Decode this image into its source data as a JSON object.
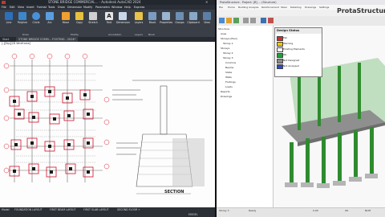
{
  "autocad": {
    "title": "STONE BRIDGE COMMERCIAL... - Autodesk AutoCAD 2024",
    "menu": [
      "File",
      "Edit",
      "View",
      "Insert",
      "Format",
      "Tools",
      "Draw",
      "Dimension",
      "Modify",
      "Parametric",
      "Window",
      "Help",
      "Express"
    ],
    "ribbon_tabs": [
      "Home",
      "Insert",
      "Annotate",
      "Parametric",
      "View",
      "Manage",
      "Output",
      "Add-ins",
      "Collaborate",
      "Express Tools",
      "Featured Apps"
    ],
    "ribbon_buttons": [
      "Line",
      "Polyline",
      "Circle",
      "Arc",
      "Move",
      "Copy",
      "Stretch",
      "Text",
      "Dimension",
      "Layers",
      "Block",
      "Properties",
      "Groups",
      "Utilities",
      "Clipboard",
      "View"
    ],
    "groups": [
      "Draw",
      "Modify",
      "Annotation",
      "Layers",
      "Block"
    ],
    "file_tabs": [
      "Start",
      "STONE BRIDGE COMM... FOOTING - 2024*"
    ],
    "viewport_label": "[-][Top][2D Wireframe]",
    "section_label": "SECTION",
    "layout_tabs": [
      "Model",
      "FOUNDATION LAYOUT",
      "FIRST BEAM LAYOUT",
      "FIRST SLAB LAYOUT",
      "SECOND FLOOR",
      "+"
    ],
    "status_text": "MODEL"
  },
  "prota": {
    "title": "ProtaStructure - Project: [B] ... (Structure)",
    "logo": "ProtaStructure",
    "menu": [
      "File",
      "Home",
      "Building Analysis",
      "Reinforcement",
      "Steel",
      "Detailing",
      "Drawings",
      "Settings"
    ],
    "tree": [
      "Structure",
      "Axes",
      "Storeys (Plan)",
      "Storey 1",
      "Storeys",
      "Storey 2",
      "Storey 3",
      "Columns",
      "Beams",
      "Slabs",
      "Walls",
      "Footings",
      "Loads",
      "Reports",
      "Drawings"
    ],
    "design_status": {
      "title": "Design Status",
      "entries": [
        {
          "label": "Fail",
          "color": "#d62b2b"
        },
        {
          "label": "Warning",
          "color": "#f2c400"
        },
        {
          "label": "Existing Elements",
          "color": "#ffffff"
        },
        {
          "label": "OK",
          "color": "#1f9e3a"
        },
        {
          "label": "Not Designed",
          "color": "#8a8a8a"
        },
        {
          "label": "Not Analysed",
          "color": "#3048c8"
        }
      ]
    },
    "status_items": [
      "Storey 3",
      "Ready",
      "0.00",
      "OK",
      "NUM"
    ]
  }
}
